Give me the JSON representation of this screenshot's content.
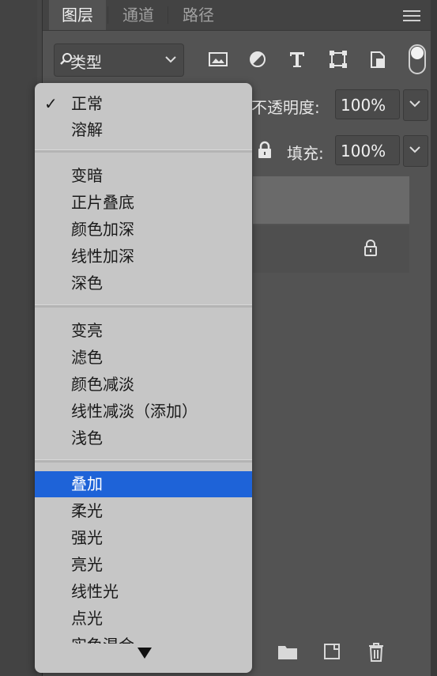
{
  "tabs": [
    "图层",
    "通道",
    "路径"
  ],
  "filter": {
    "label": "类型"
  },
  "opacity": {
    "label": "不透明度:",
    "value": "100%"
  },
  "fill": {
    "label": "填充:",
    "value": "100%"
  },
  "blend_menu": {
    "groups": [
      [
        "正常",
        "溶解"
      ],
      [
        "变暗",
        "正片叠底",
        "颜色加深",
        "线性加深",
        "深色"
      ],
      [
        "变亮",
        "滤色",
        "颜色减淡",
        "线性减淡（添加）",
        "浅色"
      ],
      [
        "叠加",
        "柔光",
        "强光",
        "亮光",
        "线性光",
        "点光"
      ]
    ],
    "checked": "正常",
    "selected": "叠加",
    "partial_item": "实色混合"
  },
  "icons": {
    "filter": "search-icon",
    "tools": [
      "image-layer-icon",
      "adjustment-layer-icon",
      "type-layer-icon",
      "shape-layer-icon",
      "smart-object-icon",
      "filter-toggle-icon"
    ],
    "bottom": [
      "new-group-icon",
      "new-layer-icon",
      "delete-icon"
    ]
  },
  "colors": {
    "selected": "#1e63d8",
    "menu_bg": "#c6c6c6",
    "panel_bg": "#535353"
  }
}
